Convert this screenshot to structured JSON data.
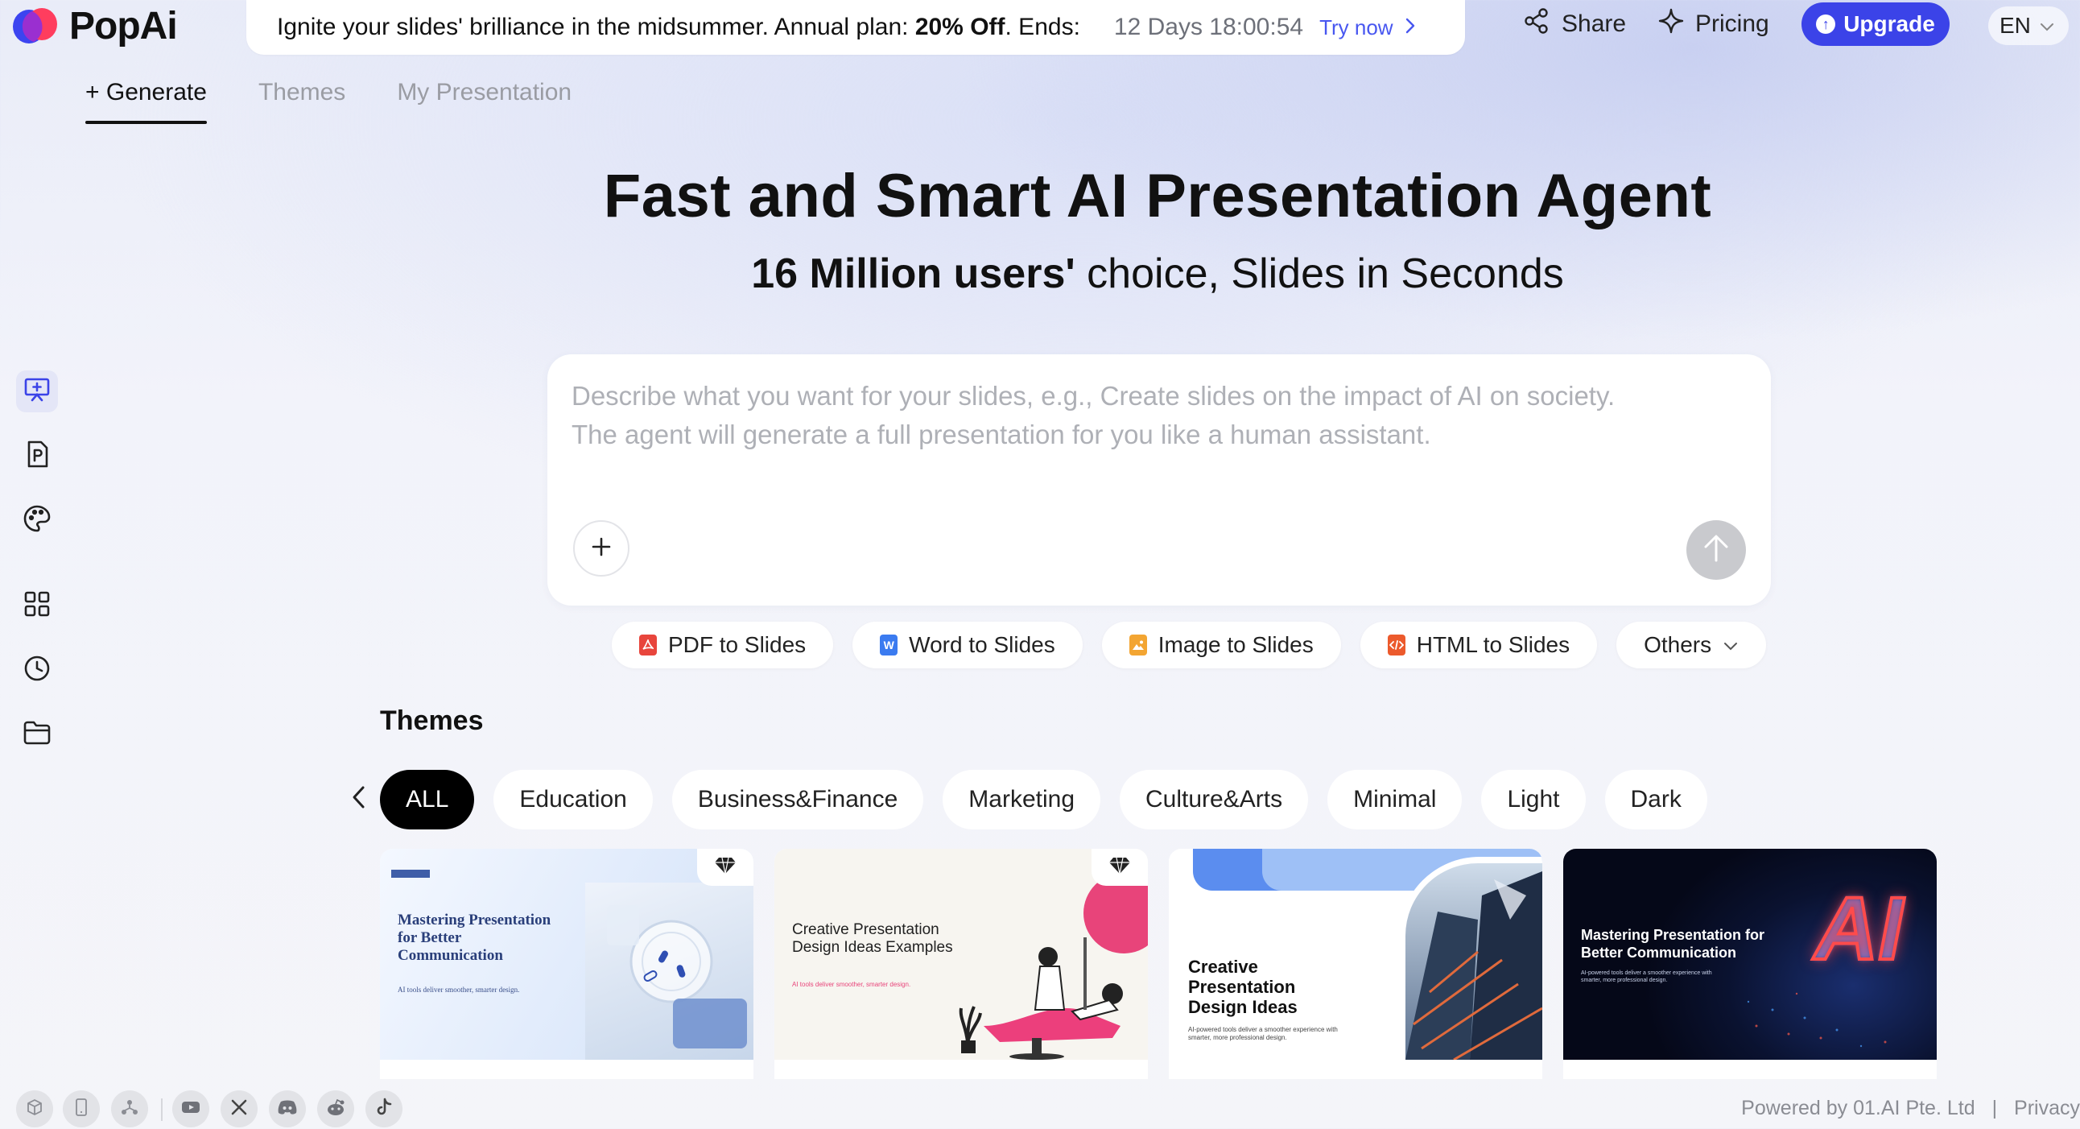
{
  "brand": {
    "name": "PopAi"
  },
  "promo": {
    "text_before": "Ignite your slides' brilliance in the midsummer. Annual plan: ",
    "discount": "20% Off",
    "text_after": ". Ends:",
    "timer": "12 Days 18:00:54",
    "cta": "Try now"
  },
  "nav": {
    "share": "Share",
    "pricing": "Pricing",
    "upgrade": "Upgrade",
    "language": "EN"
  },
  "tabs": [
    {
      "label": "+ Generate",
      "active": true
    },
    {
      "label": "Themes",
      "active": false
    },
    {
      "label": "My Presentation",
      "active": false
    }
  ],
  "rail": [
    "presentation-icon",
    "ppt-file-icon",
    "palette-icon",
    "grid-icon",
    "history-icon",
    "folder-icon"
  ],
  "hero": {
    "title": "Fast and Smart AI Presentation Agent",
    "subtitle_bold": "16 Million users'",
    "subtitle_rest": " choice, Slides in Seconds"
  },
  "prompt": {
    "placeholder": "Describe what you want for your slides, e.g., Create slides on the impact of AI on society.\nThe agent will generate a full presentation for you like a human assistant.",
    "value": ""
  },
  "converters": [
    {
      "label": "PDF to Slides",
      "icon": "pdf-icon",
      "color": "#e8453c"
    },
    {
      "label": "Word to Slides",
      "icon": "word-icon",
      "color": "#3b7bf0"
    },
    {
      "label": "Image to Slides",
      "icon": "image-icon",
      "color": "#f3a532"
    },
    {
      "label": "HTML to Slides",
      "icon": "html-icon",
      "color": "#ec5a2c"
    },
    {
      "label": "Others"
    }
  ],
  "themes": {
    "title": "Themes",
    "categories": [
      "ALL",
      "Education",
      "Business&Finance",
      "Marketing",
      "Culture&Arts",
      "Minimal",
      "Light",
      "Dark"
    ],
    "active_category": "ALL",
    "cards": [
      {
        "title": "Mastering Presentation for Better Communication",
        "subtitle": "AI tools deliver smoother, smarter design.",
        "premium": true
      },
      {
        "title": "Creative Presentation Design Ideas Examples",
        "subtitle": "AI tools deliver smoother, smarter design.",
        "premium": true
      },
      {
        "title": "Creative Presentation Design Ideas",
        "subtitle": "AI-powered tools deliver a smoother experience with smarter, more professional design.",
        "premium": false
      },
      {
        "title": "Mastering Presentation for Better Communication",
        "subtitle": "AI-powered tools deliver a smoother experience with smarter, more professional design.",
        "premium": false,
        "art_text": "AI"
      }
    ]
  },
  "footer": {
    "powered": "Powered by 01.AI Pte. Ltd",
    "divider": "|",
    "privacy": "Privacy"
  },
  "colors": {
    "accent": "#3b43e8",
    "link": "#4857f0",
    "page_bg": "#f4f5f9"
  }
}
